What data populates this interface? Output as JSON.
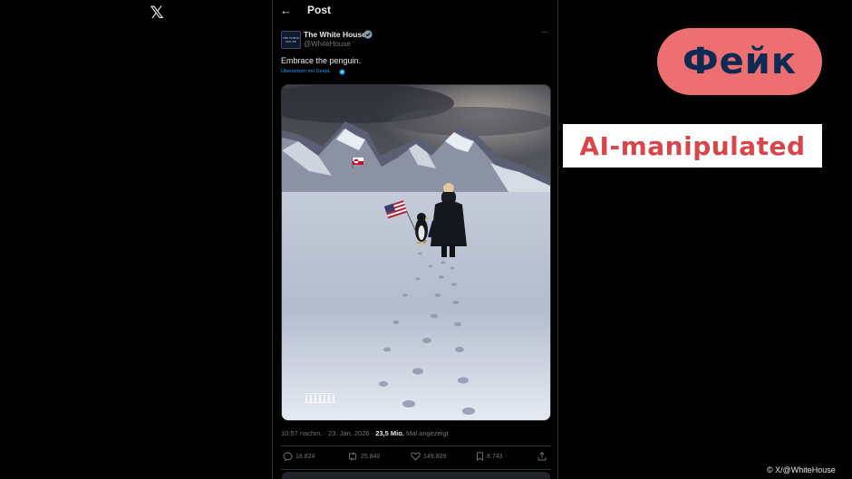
{
  "app": {
    "logo_icon": "x-logo-icon",
    "logo_glyph": "𝕏"
  },
  "header": {
    "title": "Post",
    "back_icon": "arrow-left-icon",
    "back_glyph": "←"
  },
  "post": {
    "display_name": "The White House",
    "handle": "@WhiteHouse",
    "avatar_text": "THE WHITE HOUSE",
    "text": "Embrace the penguin.",
    "translate_label": "Übersetzen mit DeepL",
    "timestamp": "10:57 nachm. · 23. Jan. 2026 · ",
    "views_count": "23,5 Mio.",
    "views_label": " Mal angezeigt",
    "more_glyph": "···"
  },
  "actions": {
    "replies": "18.824",
    "reposts": "25.840",
    "likes": "149.809",
    "bookmarks": "8.743"
  },
  "overlay": {
    "fake_label": "Фейк",
    "ai_label": "AI-manipulated",
    "credit": "© X/@WhiteHouse"
  },
  "colors": {
    "background": "#000000",
    "accent_link": "#1d9bf0",
    "fake_badge_bg": "#ee6f72",
    "fake_badge_text": "#0d2a52",
    "ai_label_text": "#d8464a"
  }
}
